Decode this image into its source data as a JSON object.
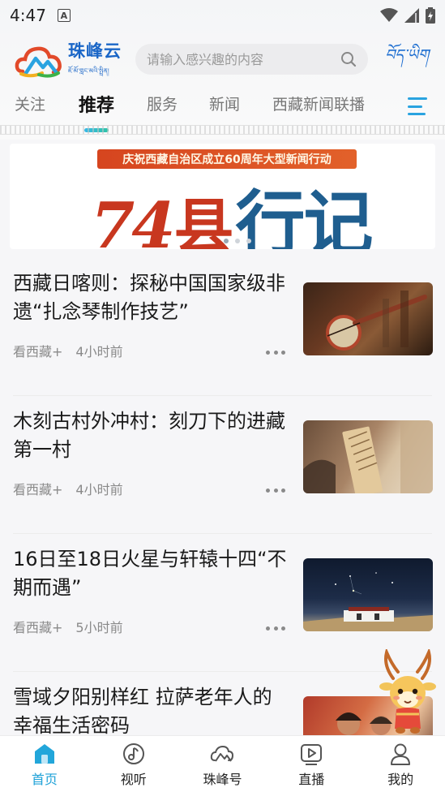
{
  "status_bar": {
    "time": "4:47",
    "notification_icon": "A"
  },
  "app": {
    "logo_name": "珠峰云",
    "logo_sub": "ཇོ་མོ་གླང་མའི་སྤྲིན།",
    "language_toggle": "བོད་ཡིག"
  },
  "search": {
    "placeholder": "请输入感兴趣的内容"
  },
  "tabs": [
    {
      "label": "关注"
    },
    {
      "label": "推荐",
      "active": true
    },
    {
      "label": "服务"
    },
    {
      "label": "新闻"
    },
    {
      "label": "西藏新闻联播"
    }
  ],
  "banner": {
    "ribbon": "庆祝西藏自治区成立60周年大型新闻行动",
    "number": "74",
    "county": "县",
    "journal": "行记"
  },
  "news": [
    {
      "title": "西藏日喀则：探秘中国国家级非遗“扎念琴制作技艺”",
      "source": "看西藏+",
      "time": "4小时前"
    },
    {
      "title": "木刻古村外冲村：刻刀下的进藏第一村",
      "source": "看西藏+",
      "time": "4小时前"
    },
    {
      "title": "16日至18日火星与轩辕十四“不期而遇”",
      "source": "看西藏+",
      "time": "5小时前"
    },
    {
      "title": "雪域夕阳别样红 拉萨老年人的幸福生活密码",
      "source": "",
      "time": ""
    }
  ],
  "bottom_nav": [
    {
      "label": "首页",
      "icon": "home-icon",
      "active": true
    },
    {
      "label": "视听",
      "icon": "music-note-icon"
    },
    {
      "label": "珠峰号",
      "icon": "cloud-logo-icon"
    },
    {
      "label": "直播",
      "icon": "play-icon"
    },
    {
      "label": "我的",
      "icon": "user-icon"
    }
  ],
  "colors": {
    "accent": "#1fa2d8",
    "brand_blue": "#1a66c7",
    "banner_red": "#c8371f",
    "banner_blue": "#1f5e8f"
  }
}
